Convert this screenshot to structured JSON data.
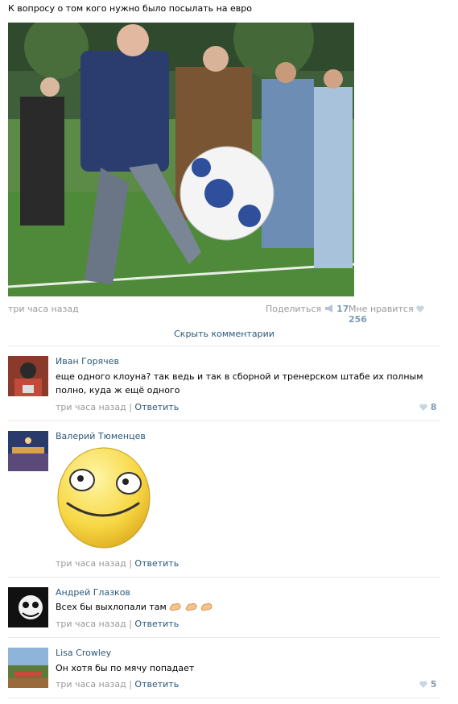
{
  "post": {
    "text": "К вопросу о том кого нужно было посылать на евро",
    "time": "три часа назад",
    "share_label": "Поделиться",
    "share_count": "17",
    "like_label": "Мне нравится",
    "like_count": "256",
    "hide_comments": "Скрыть комментарии"
  },
  "comments": [
    {
      "author": "Иван Горячев",
      "text": "еще одного клоуна? так ведь и так в сборной и тренерском штабе их полным полно, куда ж ещё одного",
      "time": "три часа назад",
      "separator": "|",
      "reply": "Ответить",
      "likes": "8"
    },
    {
      "author": "Валерий Тюменцев",
      "text": "",
      "time": "три часа назад",
      "separator": "|",
      "reply": "Ответить",
      "likes": ""
    },
    {
      "author": "Андрей Глазков",
      "text": "Всех бы выхлопали там",
      "time": "три часа назад",
      "separator": "|",
      "reply": "Ответить",
      "likes": ""
    },
    {
      "author": "Lisa Crowley",
      "text": "Он хотя бы по мячу попадает",
      "time": "три часа назад",
      "separator": "|",
      "reply": "Ответить",
      "likes": "5"
    }
  ],
  "colors": {
    "link": "#2b587a",
    "muted": "#999999",
    "like_count": "#7f9bb8",
    "separator": "#e4e8ed"
  },
  "icons": {
    "share": "megaphone-icon",
    "like": "heart-icon",
    "sticker": "smiley-sticker",
    "emoji": "flexed-biceps-emoji"
  }
}
